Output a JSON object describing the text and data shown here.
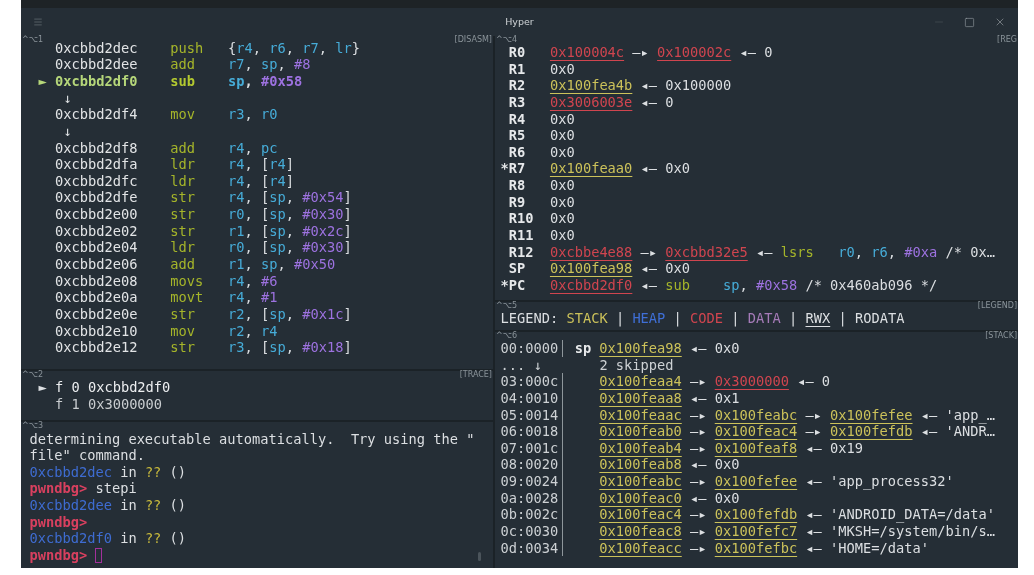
{
  "window": {
    "title": "Hyper"
  },
  "disasm": {
    "pane_key": "^⌥1",
    "pane_title": "[DISASM]",
    "lines": [
      {
        "kind": "instruction",
        "selected": false,
        "address": "0xcbbd2dec",
        "mnemonic": "push",
        "operands": [
          {
            "text": "{",
            "kind": "plain"
          },
          {
            "text": "r4",
            "kind": "register"
          },
          {
            "text": ", ",
            "kind": "plain"
          },
          {
            "text": "r6",
            "kind": "register"
          },
          {
            "text": ", ",
            "kind": "plain"
          },
          {
            "text": "r7",
            "kind": "register"
          },
          {
            "text": ", ",
            "kind": "plain"
          },
          {
            "text": "lr",
            "kind": "register"
          },
          {
            "text": "}",
            "kind": "plain"
          }
        ]
      },
      {
        "kind": "instruction",
        "selected": false,
        "address": "0xcbbd2dee",
        "mnemonic": "add",
        "operands": [
          {
            "text": "r7",
            "kind": "register"
          },
          {
            "text": ", ",
            "kind": "plain"
          },
          {
            "text": "sp",
            "kind": "register"
          },
          {
            "text": ", ",
            "kind": "plain"
          },
          {
            "text": "#8",
            "kind": "immediate"
          }
        ]
      },
      {
        "kind": "instruction",
        "selected": true,
        "marker": "►",
        "address": "0xcbbd2df0",
        "mnemonic": "sub",
        "operands": [
          {
            "text": "sp",
            "kind": "register"
          },
          {
            "text": ", ",
            "kind": "plain"
          },
          {
            "text": "#0x58",
            "kind": "immediate"
          }
        ]
      },
      {
        "kind": "jump",
        "text": "↓"
      },
      {
        "kind": "instruction",
        "selected": false,
        "address": "0xcbbd2df4",
        "mnemonic": "mov",
        "operands": [
          {
            "text": "r3",
            "kind": "register"
          },
          {
            "text": ", ",
            "kind": "plain"
          },
          {
            "text": "r0",
            "kind": "register"
          }
        ]
      },
      {
        "kind": "jump",
        "text": "↓"
      },
      {
        "kind": "instruction",
        "selected": false,
        "address": "0xcbbd2df8",
        "mnemonic": "add",
        "operands": [
          {
            "text": "r4",
            "kind": "register"
          },
          {
            "text": ", ",
            "kind": "plain"
          },
          {
            "text": "pc",
            "kind": "register"
          }
        ]
      },
      {
        "kind": "instruction",
        "selected": false,
        "address": "0xcbbd2dfa",
        "mnemonic": "ldr",
        "operands": [
          {
            "text": "r4",
            "kind": "register"
          },
          {
            "text": ", [",
            "kind": "plain"
          },
          {
            "text": "r4",
            "kind": "register"
          },
          {
            "text": "]",
            "kind": "plain"
          }
        ]
      },
      {
        "kind": "instruction",
        "selected": false,
        "address": "0xcbbd2dfc",
        "mnemonic": "ldr",
        "operands": [
          {
            "text": "r4",
            "kind": "register"
          },
          {
            "text": ", [",
            "kind": "plain"
          },
          {
            "text": "r4",
            "kind": "register"
          },
          {
            "text": "]",
            "kind": "plain"
          }
        ]
      },
      {
        "kind": "instruction",
        "selected": false,
        "address": "0xcbbd2dfe",
        "mnemonic": "str",
        "operands": [
          {
            "text": "r4",
            "kind": "register"
          },
          {
            "text": ", [",
            "kind": "plain"
          },
          {
            "text": "sp",
            "kind": "register"
          },
          {
            "text": ", ",
            "kind": "plain"
          },
          {
            "text": "#0x54",
            "kind": "immediate"
          },
          {
            "text": "]",
            "kind": "plain"
          }
        ]
      },
      {
        "kind": "instruction",
        "selected": false,
        "address": "0xcbbd2e00",
        "mnemonic": "str",
        "operands": [
          {
            "text": "r0",
            "kind": "register"
          },
          {
            "text": ", [",
            "kind": "plain"
          },
          {
            "text": "sp",
            "kind": "register"
          },
          {
            "text": ", ",
            "kind": "plain"
          },
          {
            "text": "#0x30",
            "kind": "immediate"
          },
          {
            "text": "]",
            "kind": "plain"
          }
        ]
      },
      {
        "kind": "instruction",
        "selected": false,
        "address": "0xcbbd2e02",
        "mnemonic": "str",
        "operands": [
          {
            "text": "r1",
            "kind": "register"
          },
          {
            "text": ", [",
            "kind": "plain"
          },
          {
            "text": "sp",
            "kind": "register"
          },
          {
            "text": ", ",
            "kind": "plain"
          },
          {
            "text": "#0x2c",
            "kind": "immediate"
          },
          {
            "text": "]",
            "kind": "plain"
          }
        ]
      },
      {
        "kind": "instruction",
        "selected": false,
        "address": "0xcbbd2e04",
        "mnemonic": "ldr",
        "operands": [
          {
            "text": "r0",
            "kind": "register"
          },
          {
            "text": ", [",
            "kind": "plain"
          },
          {
            "text": "sp",
            "kind": "register"
          },
          {
            "text": ", ",
            "kind": "plain"
          },
          {
            "text": "#0x30",
            "kind": "immediate"
          },
          {
            "text": "]",
            "kind": "plain"
          }
        ]
      },
      {
        "kind": "instruction",
        "selected": false,
        "address": "0xcbbd2e06",
        "mnemonic": "add",
        "operands": [
          {
            "text": "r1",
            "kind": "register"
          },
          {
            "text": ", ",
            "kind": "plain"
          },
          {
            "text": "sp",
            "kind": "register"
          },
          {
            "text": ", ",
            "kind": "plain"
          },
          {
            "text": "#0x50",
            "kind": "immediate"
          }
        ]
      },
      {
        "kind": "instruction",
        "selected": false,
        "address": "0xcbbd2e08",
        "mnemonic": "movs",
        "operands": [
          {
            "text": "r4",
            "kind": "register"
          },
          {
            "text": ", ",
            "kind": "plain"
          },
          {
            "text": "#6",
            "kind": "immediate"
          }
        ]
      },
      {
        "kind": "instruction",
        "selected": false,
        "address": "0xcbbd2e0a",
        "mnemonic": "movt",
        "operands": [
          {
            "text": "r4",
            "kind": "register"
          },
          {
            "text": ", ",
            "kind": "plain"
          },
          {
            "text": "#1",
            "kind": "immediate"
          }
        ]
      },
      {
        "kind": "instruction",
        "selected": false,
        "address": "0xcbbd2e0e",
        "mnemonic": "str",
        "operands": [
          {
            "text": "r2",
            "kind": "register"
          },
          {
            "text": ", [",
            "kind": "plain"
          },
          {
            "text": "sp",
            "kind": "register"
          },
          {
            "text": ", ",
            "kind": "plain"
          },
          {
            "text": "#0x1c",
            "kind": "immediate"
          },
          {
            "text": "]",
            "kind": "plain"
          }
        ]
      },
      {
        "kind": "instruction",
        "selected": false,
        "address": "0xcbbd2e10",
        "mnemonic": "mov",
        "operands": [
          {
            "text": "r2",
            "kind": "register"
          },
          {
            "text": ", ",
            "kind": "plain"
          },
          {
            "text": "r4",
            "kind": "register"
          }
        ]
      },
      {
        "kind": "instruction",
        "selected": false,
        "address": "0xcbbd2e12",
        "mnemonic": "str",
        "operands": [
          {
            "text": "r3",
            "kind": "register"
          },
          {
            "text": ", [",
            "kind": "plain"
          },
          {
            "text": "sp",
            "kind": "register"
          },
          {
            "text": ", ",
            "kind": "plain"
          },
          {
            "text": "#0x18",
            "kind": "immediate"
          },
          {
            "text": "]",
            "kind": "plain"
          }
        ]
      }
    ]
  },
  "trace": {
    "pane_key": "^⌥2",
    "pane_title": "[TRACE]",
    "frames": [
      {
        "selected": true,
        "marker": "►",
        "text": "f 0 0xcbbd2df0"
      },
      {
        "selected": false,
        "text": "f 1 0x3000000"
      }
    ]
  },
  "console": {
    "pane_key": "^⌥3",
    "lines": [
      {
        "kind": "output",
        "text": "determining executable automatically.  Try using the \"file\" command."
      },
      {
        "kind": "location",
        "address": "0xcbbd2dec",
        "word": "in",
        "function": "??",
        "args": "()"
      },
      {
        "kind": "prompt",
        "prompt": "pwndbg>",
        "command": "stepi",
        "cursor": false
      },
      {
        "kind": "location",
        "address": "0xcbbd2dee",
        "word": "in",
        "function": "??",
        "args": "()"
      },
      {
        "kind": "prompt",
        "prompt": "pwndbg>",
        "cursor": false
      },
      {
        "kind": "location",
        "address": "0xcbbd2df0",
        "word": "in",
        "function": "??",
        "args": "()"
      },
      {
        "kind": "prompt",
        "prompt": "pwndbg>",
        "cursor": true
      }
    ]
  },
  "registers": {
    "pane_key": "^⌥4",
    "pane_title": "[REG",
    "rows": [
      {
        "name": "R0",
        "changed": false,
        "value": [
          {
            "text": "0x100004c",
            "kind": "code"
          },
          {
            "text": " —▸ ",
            "kind": "plain"
          },
          {
            "text": "0x100002c",
            "kind": "code"
          },
          {
            "text": " ◂— 0",
            "kind": "plain"
          }
        ]
      },
      {
        "name": "R1",
        "changed": false,
        "value": [
          {
            "text": "0x0",
            "kind": "plain"
          }
        ]
      },
      {
        "name": "R2",
        "changed": false,
        "value": [
          {
            "text": "0x100fea4b",
            "kind": "stack"
          },
          {
            "text": " ◂— 0x100000",
            "kind": "plain"
          }
        ]
      },
      {
        "name": "R3",
        "changed": false,
        "value": [
          {
            "text": "0x3006003e",
            "kind": "code"
          },
          {
            "text": " ◂— 0",
            "kind": "plain"
          }
        ]
      },
      {
        "name": "R4",
        "changed": false,
        "value": [
          {
            "text": "0x0",
            "kind": "plain"
          }
        ]
      },
      {
        "name": "R5",
        "changed": false,
        "value": [
          {
            "text": "0x0",
            "kind": "plain"
          }
        ]
      },
      {
        "name": "R6",
        "changed": false,
        "value": [
          {
            "text": "0x0",
            "kind": "plain"
          }
        ]
      },
      {
        "name": "R7",
        "changed": true,
        "marker": "*",
        "value": [
          {
            "text": "0x100feaa0",
            "kind": "stack"
          },
          {
            "text": " ◂— 0x0",
            "kind": "plain"
          }
        ]
      },
      {
        "name": "R8",
        "changed": false,
        "value": [
          {
            "text": "0x0",
            "kind": "plain"
          }
        ]
      },
      {
        "name": "R9",
        "changed": false,
        "value": [
          {
            "text": "0x0",
            "kind": "plain"
          }
        ]
      },
      {
        "name": "R10",
        "changed": false,
        "value": [
          {
            "text": "0x0",
            "kind": "plain"
          }
        ]
      },
      {
        "name": "R11",
        "changed": false,
        "value": [
          {
            "text": "0x0",
            "kind": "plain"
          }
        ]
      },
      {
        "name": "R12",
        "changed": false,
        "value": [
          {
            "text": "0xcbbe4e88",
            "kind": "code"
          },
          {
            "text": " —▸ ",
            "kind": "plain"
          },
          {
            "text": "0xcbbd32e5",
            "kind": "code"
          },
          {
            "text": " ◂— ",
            "kind": "plain"
          },
          {
            "text": "lsrs",
            "kind": "mnemonic"
          },
          {
            "text": "r0",
            "kind": "register"
          },
          {
            "text": ", ",
            "kind": "plain"
          },
          {
            "text": "r6",
            "kind": "register"
          },
          {
            "text": ", ",
            "kind": "plain"
          },
          {
            "text": "#0xa",
            "kind": "immediate"
          },
          {
            "text": " /* 0x…",
            "kind": "plain"
          }
        ]
      },
      {
        "name": "SP",
        "changed": false,
        "value": [
          {
            "text": "0x100fea98",
            "kind": "stack"
          },
          {
            "text": " ◂— 0x0",
            "kind": "plain"
          }
        ]
      },
      {
        "name": "PC",
        "changed": true,
        "marker": "*",
        "value": [
          {
            "text": "0xcbbd2df0",
            "kind": "code"
          },
          {
            "text": " ◂— ",
            "kind": "plain"
          },
          {
            "text": "sub",
            "kind": "mnemonic"
          },
          {
            "text": "sp",
            "kind": "register"
          },
          {
            "text": ", ",
            "kind": "plain"
          },
          {
            "text": "#0x58",
            "kind": "immediate"
          },
          {
            "text": " /* 0x460ab096 */",
            "kind": "plain"
          }
        ]
      }
    ]
  },
  "legend": {
    "pane_key": "^⌥5",
    "pane_title": "[LEGEND]",
    "items": [
      {
        "text": "LEGEND: ",
        "kind": "plain"
      },
      {
        "text": "STACK",
        "kind": "stack_label"
      },
      {
        "text": " | ",
        "kind": "plain"
      },
      {
        "text": "HEAP",
        "kind": "heap"
      },
      {
        "text": " | ",
        "kind": "plain"
      },
      {
        "text": "CODE",
        "kind": "code_label"
      },
      {
        "text": " | ",
        "kind": "plain"
      },
      {
        "text": "DATA",
        "kind": "data"
      },
      {
        "text": " | ",
        "kind": "plain"
      },
      {
        "text": "RWX",
        "kind": "rwx"
      },
      {
        "text": " | ",
        "kind": "plain"
      },
      {
        "text": "RODATA",
        "kind": "plain"
      }
    ]
  },
  "stack": {
    "pane_key": "^⌥6",
    "pane_title": "[STACK]",
    "rows": [
      {
        "kind": "entry",
        "offset": "00:0000",
        "pointer": "sp",
        "value": [
          {
            "text": "0x100fea98",
            "kind": "stack"
          },
          {
            "text": " ◂— 0x0",
            "kind": "plain"
          }
        ]
      },
      {
        "kind": "skipped",
        "offset": "... ↓",
        "text": "2 skipped"
      },
      {
        "kind": "entry",
        "offset": "03:000c",
        "value": [
          {
            "text": "0x100feaa4",
            "kind": "stack"
          },
          {
            "text": " —▸ ",
            "kind": "plain"
          },
          {
            "text": "0x3000000",
            "kind": "code"
          },
          {
            "text": " ◂— 0",
            "kind": "plain"
          }
        ]
      },
      {
        "kind": "entry",
        "offset": "04:0010",
        "value": [
          {
            "text": "0x100feaa8",
            "kind": "stack"
          },
          {
            "text": " ◂— 0x1",
            "kind": "plain"
          }
        ]
      },
      {
        "kind": "entry",
        "offset": "05:0014",
        "value": [
          {
            "text": "0x100feaac",
            "kind": "stack"
          },
          {
            "text": " —▸ ",
            "kind": "plain"
          },
          {
            "text": "0x100feabc",
            "kind": "stack"
          },
          {
            "text": " —▸ ",
            "kind": "plain"
          },
          {
            "text": "0x100fefee",
            "kind": "stack"
          },
          {
            "text": " ◂— 'app_…",
            "kind": "plain"
          }
        ]
      },
      {
        "kind": "entry",
        "offset": "06:0018",
        "value": [
          {
            "text": "0x100feab0",
            "kind": "stack"
          },
          {
            "text": " —▸ ",
            "kind": "plain"
          },
          {
            "text": "0x100feac4",
            "kind": "stack"
          },
          {
            "text": " —▸ ",
            "kind": "plain"
          },
          {
            "text": "0x100fefdb",
            "kind": "stack"
          },
          {
            "text": " ◂— 'ANDR…",
            "kind": "plain"
          }
        ]
      },
      {
        "kind": "entry",
        "offset": "07:001c",
        "value": [
          {
            "text": "0x100feab4",
            "kind": "stack"
          },
          {
            "text": " —▸ ",
            "kind": "plain"
          },
          {
            "text": "0x100feaf8",
            "kind": "stack"
          },
          {
            "text": " ◂— 0x19",
            "kind": "plain"
          }
        ]
      },
      {
        "kind": "entry",
        "offset": "08:0020",
        "value": [
          {
            "text": "0x100feab8",
            "kind": "stack"
          },
          {
            "text": " ◂— 0x0",
            "kind": "plain"
          }
        ]
      },
      {
        "kind": "entry",
        "offset": "09:0024",
        "value": [
          {
            "text": "0x100feabc",
            "kind": "stack"
          },
          {
            "text": " —▸ ",
            "kind": "plain"
          },
          {
            "text": "0x100fefee",
            "kind": "stack"
          },
          {
            "text": " ◂— 'app_process32'",
            "kind": "plain"
          }
        ]
      },
      {
        "kind": "entry",
        "offset": "0a:0028",
        "value": [
          {
            "text": "0x100feac0",
            "kind": "stack"
          },
          {
            "text": " ◂— 0x0",
            "kind": "plain"
          }
        ]
      },
      {
        "kind": "entry",
        "offset": "0b:002c",
        "value": [
          {
            "text": "0x100feac4",
            "kind": "stack"
          },
          {
            "text": " —▸ ",
            "kind": "plain"
          },
          {
            "text": "0x100fefdb",
            "kind": "stack"
          },
          {
            "text": " ◂— 'ANDROID_DATA=/data'",
            "kind": "plain"
          }
        ]
      },
      {
        "kind": "entry",
        "offset": "0c:0030",
        "value": [
          {
            "text": "0x100feac8",
            "kind": "stack"
          },
          {
            "text": " —▸ ",
            "kind": "plain"
          },
          {
            "text": "0x100fefc7",
            "kind": "stack"
          },
          {
            "text": " ◂— 'MKSH=/system/bin/s…",
            "kind": "plain"
          }
        ]
      },
      {
        "kind": "entry",
        "offset": "0d:0034",
        "value": [
          {
            "text": "0x100feacc",
            "kind": "stack"
          },
          {
            "text": " —▸ ",
            "kind": "plain"
          },
          {
            "text": "0x100fefbc",
            "kind": "stack"
          },
          {
            "text": " ◂— 'HOME=/data'",
            "kind": "plain"
          }
        ]
      }
    ]
  }
}
